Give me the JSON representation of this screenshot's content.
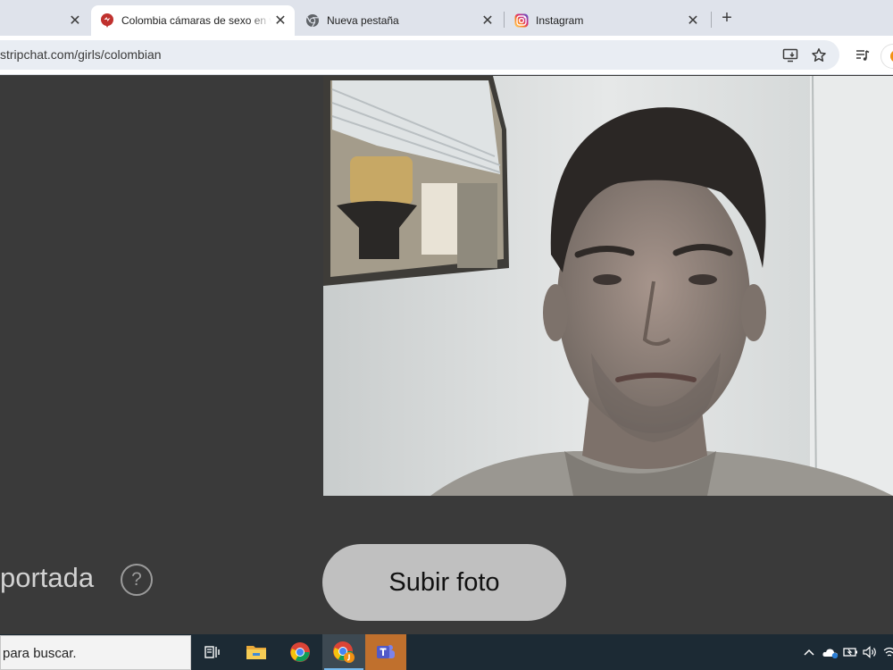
{
  "browser": {
    "tabs": [
      {
        "title": "",
        "active": false
      },
      {
        "title": "Colombia cámaras de sexo en vivo",
        "active": true
      },
      {
        "title": "Nueva pestaña",
        "active": false
      },
      {
        "title": "Instagram",
        "active": false
      }
    ],
    "close_glyph": "✕",
    "new_tab_glyph": "+",
    "address": "stripchat.com/girls/colombian"
  },
  "page": {
    "section_label": "portada",
    "help_glyph": "?",
    "upload_button_label": "Subir foto"
  },
  "taskbar": {
    "search_placeholder": "para buscar."
  },
  "colors": {
    "page_background": "#3a3a3a",
    "upload_button": "#c0c0c0",
    "taskbar": "#1c2a34",
    "stripchat_red": "#c0312e",
    "chrome_red": "#db4437",
    "chrome_yellow": "#f4c20d",
    "chrome_green": "#0f9d58",
    "chrome_blue": "#4285f4",
    "teams_purple": "#5059c9"
  }
}
